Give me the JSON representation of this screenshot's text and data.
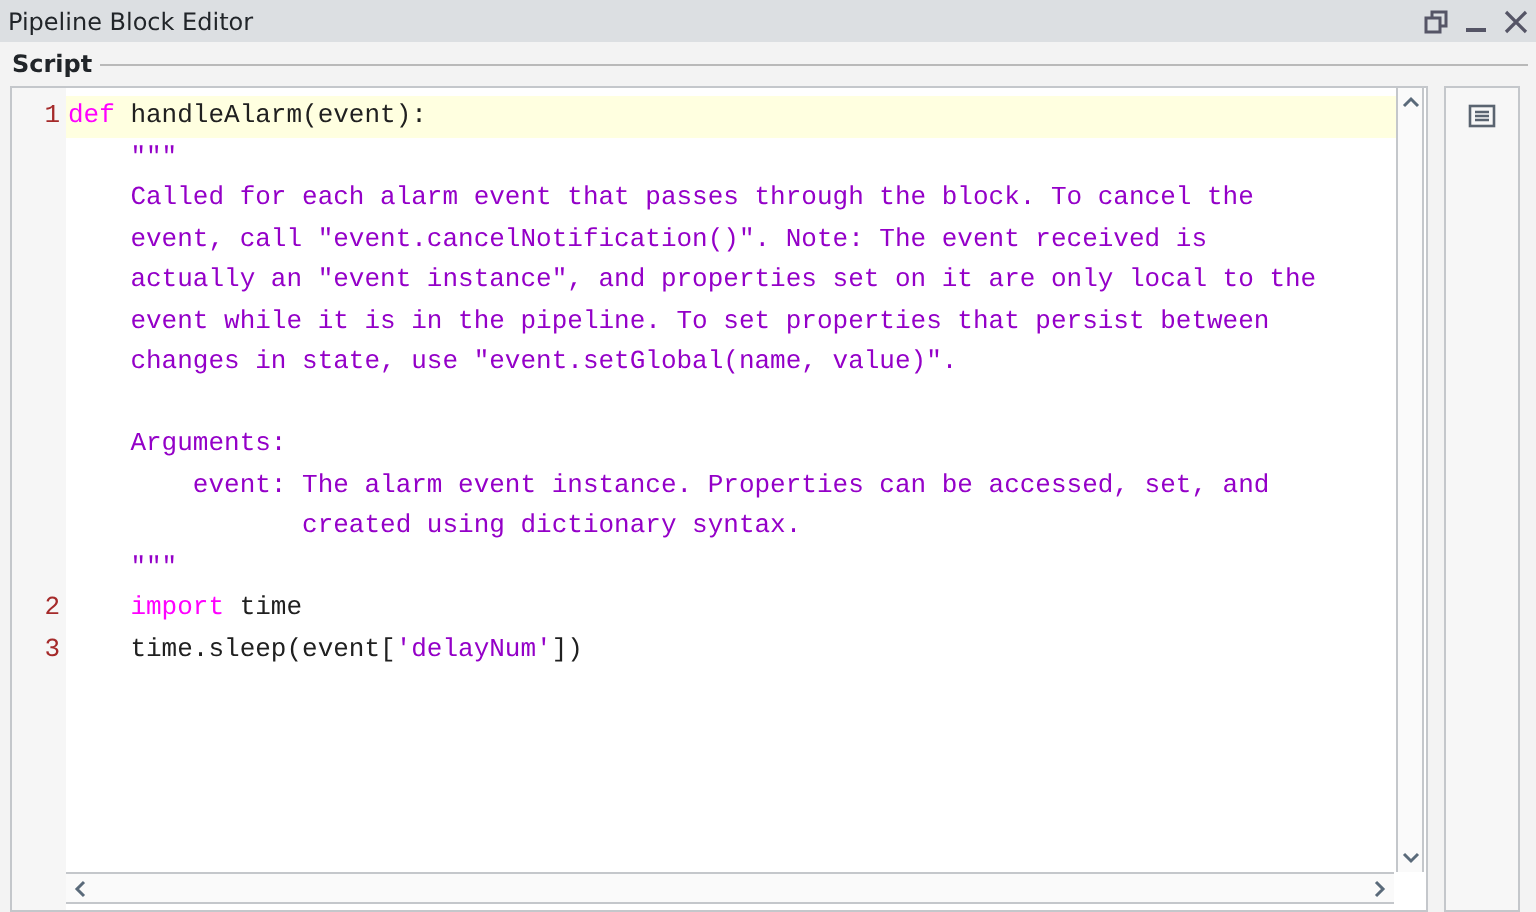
{
  "window": {
    "title": "Pipeline Block Editor"
  },
  "section": {
    "label": "Script"
  },
  "code_lines": [
    {
      "number": "1",
      "highlighted": true,
      "tokens": [
        {
          "kind": "keyword",
          "text": "def"
        },
        {
          "kind": "plain",
          "text": " handleAlarm(event):"
        }
      ]
    },
    {
      "highlighted": false,
      "tokens": [
        {
          "kind": "string",
          "text": "    \"\"\""
        }
      ]
    },
    {
      "highlighted": false,
      "tokens": [
        {
          "kind": "string",
          "text": "    Called for each alarm event that passes through the block. To cancel the"
        }
      ]
    },
    {
      "highlighted": false,
      "tokens": [
        {
          "kind": "string",
          "text": "    event, call \"event.cancelNotification()\". Note: The event received is"
        }
      ]
    },
    {
      "highlighted": false,
      "tokens": [
        {
          "kind": "string",
          "text": "    actually an \"event instance\", and properties set on it are only local to the"
        }
      ]
    },
    {
      "highlighted": false,
      "tokens": [
        {
          "kind": "string",
          "text": "    event while it is in the pipeline. To set properties that persist between"
        }
      ]
    },
    {
      "highlighted": false,
      "tokens": [
        {
          "kind": "string",
          "text": "    changes in state, use \"event.setGlobal(name, value)\"."
        }
      ]
    },
    {
      "highlighted": false
    },
    {
      "highlighted": false,
      "tokens": [
        {
          "kind": "string",
          "text": "    Arguments:"
        }
      ]
    },
    {
      "highlighted": false,
      "tokens": [
        {
          "kind": "string",
          "text": "        event: The alarm event instance. Properties can be accessed, set, and"
        }
      ]
    },
    {
      "highlighted": false,
      "tokens": [
        {
          "kind": "string",
          "text": "               created using dictionary syntax."
        }
      ]
    },
    {
      "highlighted": false,
      "tokens": [
        {
          "kind": "string",
          "text": "    \"\"\""
        }
      ]
    },
    {
      "number": "2",
      "highlighted": false,
      "tokens": [
        {
          "kind": "keyword",
          "text": "    import"
        },
        {
          "kind": "plain",
          "text": " time"
        }
      ]
    },
    {
      "number": "3",
      "highlighted": false,
      "tokens": [
        {
          "kind": "plain",
          "text": "    time.sleep(event["
        },
        {
          "kind": "string",
          "text": "'delayNum'"
        },
        {
          "kind": "plain",
          "text": "])"
        }
      ]
    }
  ]
}
